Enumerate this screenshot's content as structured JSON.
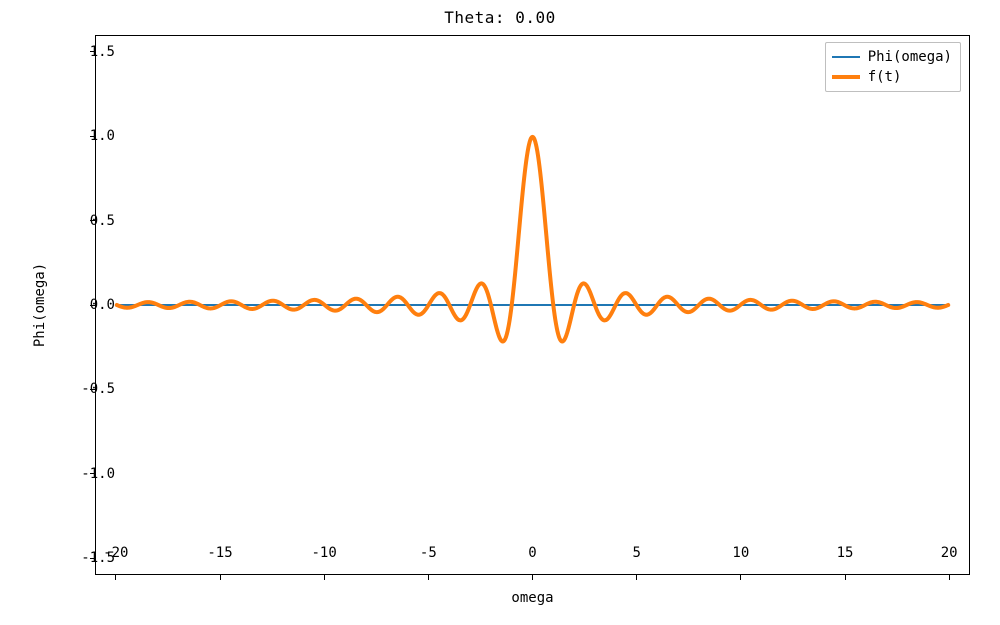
{
  "chart_data": {
    "type": "line",
    "title": "Theta: 0.00",
    "xlabel": "omega",
    "ylabel": "Phi(omega)",
    "xlim": [
      -21,
      21
    ],
    "ylim": [
      -1.6,
      1.6
    ],
    "xticks": [
      -20,
      -15,
      -10,
      -5,
      0,
      5,
      10,
      15,
      20
    ],
    "yticks": [
      -1.5,
      -1.0,
      -0.5,
      0.0,
      0.5,
      1.0,
      1.5
    ],
    "legend_position": "upper right",
    "series": [
      {
        "name": "Phi(omega)",
        "color": "#1f77b4",
        "linewidth": 2,
        "x": [
          -20,
          -15,
          -10,
          -5,
          0,
          5,
          10,
          15,
          20
        ],
        "values": [
          0,
          0,
          0,
          0,
          0,
          0,
          0,
          0,
          0
        ]
      },
      {
        "name": "f(t)",
        "color": "#ff7f0e",
        "linewidth": 4,
        "function": "sinc(t) = sin(pi*t)/(pi*t)",
        "x_range": [
          -20,
          20
        ],
        "sample_envelope": [
          {
            "x": -20,
            "y": 0.0
          },
          {
            "x": -15,
            "y": 0.0
          },
          {
            "x": -10,
            "y": 0.0
          },
          {
            "x": -5,
            "y": 0.0
          },
          {
            "x": -2.5,
            "y": 0.13
          },
          {
            "x": -1.5,
            "y": -0.22
          },
          {
            "x": -0.5,
            "y": 0.64
          },
          {
            "x": 0,
            "y": 1.0
          },
          {
            "x": 0.5,
            "y": 0.64
          },
          {
            "x": 1.5,
            "y": -0.22
          },
          {
            "x": 2.5,
            "y": 0.13
          },
          {
            "x": 5,
            "y": 0.0
          },
          {
            "x": 10,
            "y": 0.0
          },
          {
            "x": 15,
            "y": 0.0
          },
          {
            "x": 20,
            "y": 0.0
          }
        ]
      }
    ]
  },
  "legend": {
    "item0": "Phi(omega)",
    "item1": "f(t)"
  },
  "ticks": {
    "x": {
      "t0": "-20",
      "t1": "-15",
      "t2": "-10",
      "t3": "-5",
      "t4": "0",
      "t5": "5",
      "t6": "10",
      "t7": "15",
      "t8": "20"
    },
    "y": {
      "t0": "-1.5",
      "t1": "-1.0",
      "t2": "-0.5",
      "t3": "0.0",
      "t4": "0.5",
      "t5": "1.0",
      "t6": "1.5"
    }
  },
  "labels": {
    "title": "Theta: 0.00",
    "xlabel": "omega",
    "ylabel": "Phi(omega)"
  }
}
